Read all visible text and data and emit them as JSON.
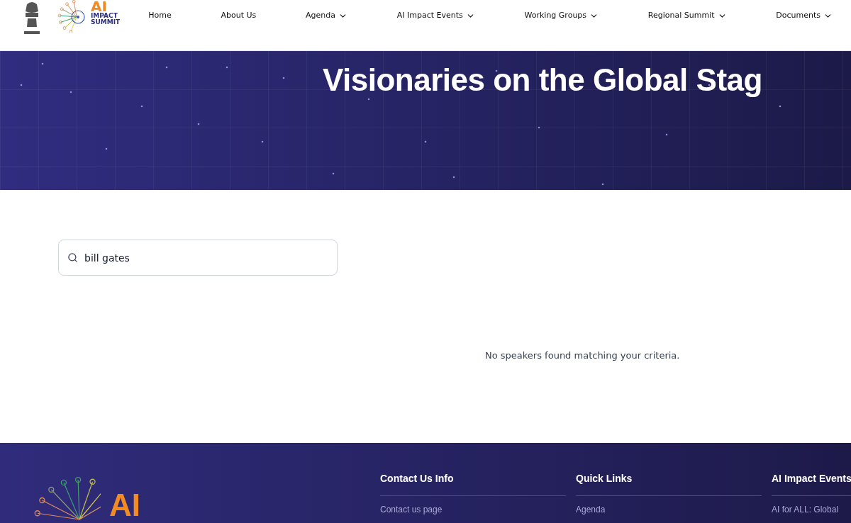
{
  "header": {
    "logo": {
      "mark": "AI",
      "line1": "IMPACT",
      "line2": "SUMMIT"
    },
    "nav": [
      {
        "label": "Home",
        "dropdown": false
      },
      {
        "label": "About Us",
        "dropdown": false
      },
      {
        "label": "Agenda",
        "dropdown": true
      },
      {
        "label": "AI Impact Events",
        "dropdown": true
      },
      {
        "label": "Working Groups",
        "dropdown": true
      },
      {
        "label": "Regional Summit",
        "dropdown": true
      },
      {
        "label": "Documents",
        "dropdown": true
      }
    ]
  },
  "hero": {
    "title": "Visionaries on the Global Stag"
  },
  "search": {
    "value": "bill gates"
  },
  "empty_message": "No speakers found matching your criteria.",
  "footer": {
    "logo_mark": "AI",
    "columns": [
      {
        "heading": "Contact Us Info",
        "links": [
          "Contact us page"
        ]
      },
      {
        "heading": "Quick Links",
        "links": [
          "Agenda"
        ]
      },
      {
        "heading": "AI Impact Events",
        "links": [
          "AI for ALL: Global"
        ]
      }
    ]
  }
}
